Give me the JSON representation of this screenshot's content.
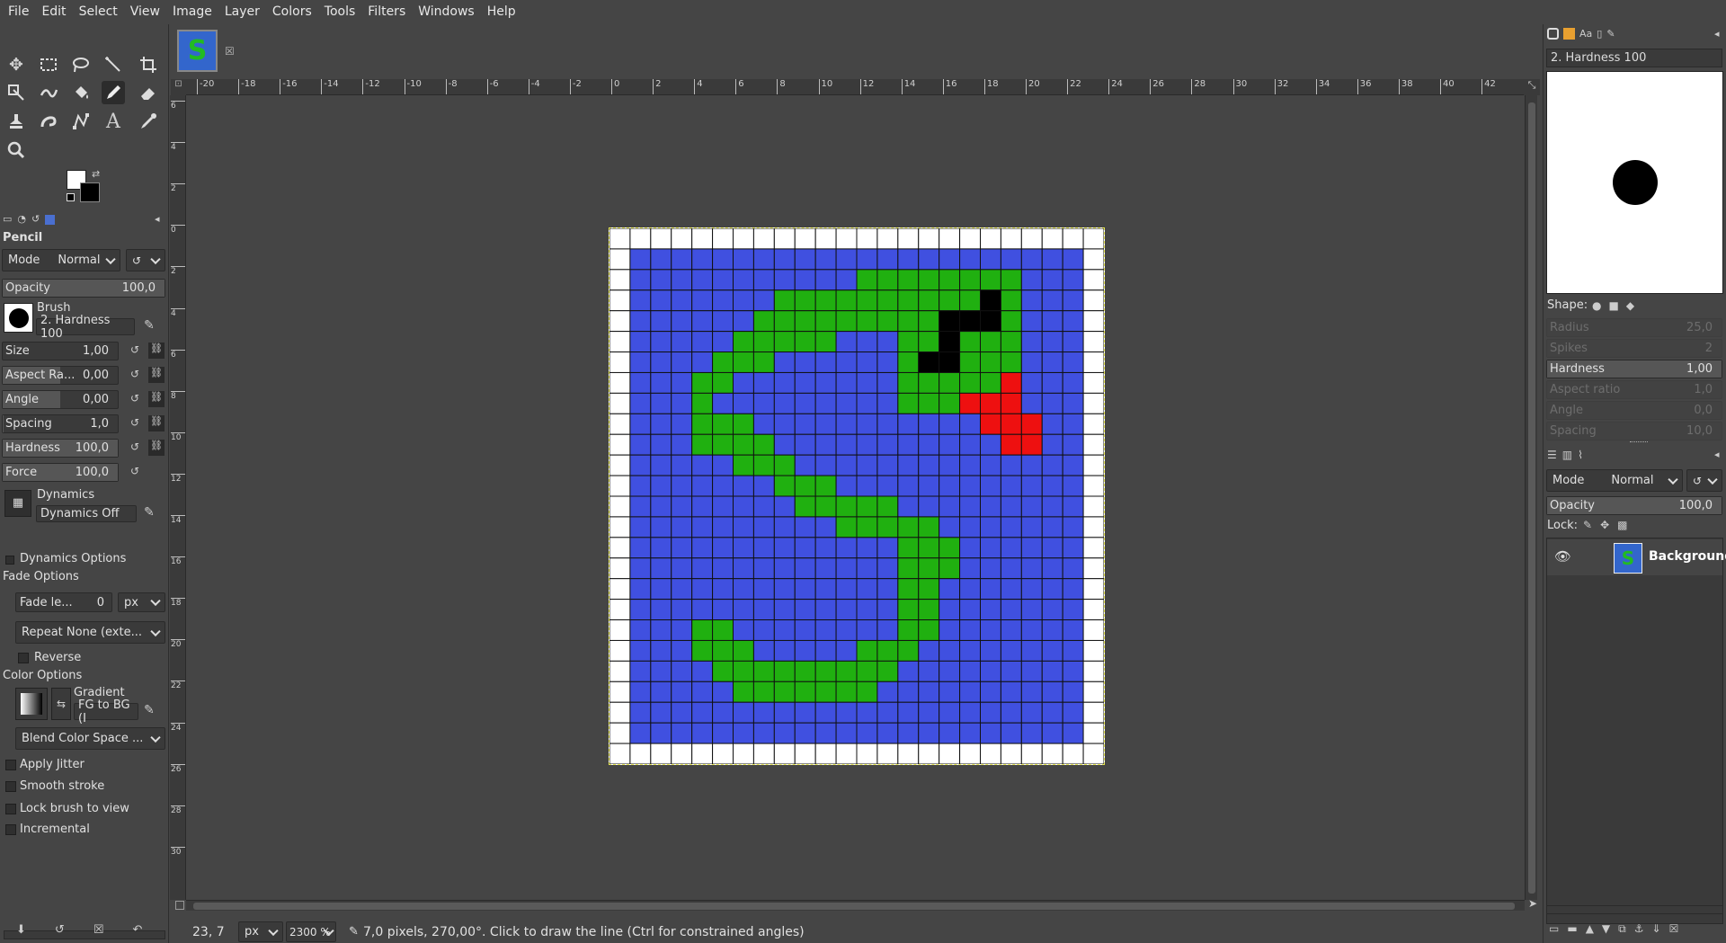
{
  "menu": [
    "File",
    "Edit",
    "Select",
    "View",
    "Image",
    "Layer",
    "Colors",
    "Tools",
    "Filters",
    "Windows",
    "Help"
  ],
  "tool_options": {
    "title": "Pencil",
    "mode_label": "Mode",
    "mode_value": "Normal",
    "opacity_label": "Opacity",
    "opacity_value": "100,0",
    "brush_label": "Brush",
    "brush_value": "2. Hardness 100",
    "size_label": "Size",
    "size_value": "1,00",
    "aspect_label": "Aspect Ra...",
    "aspect_value": "0,00",
    "angle_label": "Angle",
    "angle_value": "0,00",
    "spacing_label": "Spacing",
    "spacing_value": "1,0",
    "hardness_label": "Hardness",
    "hardness_value": "100,0",
    "force_label": "Force",
    "force_value": "100,0",
    "dynamics_label": "Dynamics",
    "dynamics_value": "Dynamics Off",
    "dynamics_options": "Dynamics Options",
    "fade_options": "Fade Options",
    "fade_length_label": "Fade le...",
    "fade_length_value": "0",
    "fade_unit": "px",
    "repeat_value": "Repeat None (exte...",
    "reverse_label": "Reverse",
    "color_options": "Color Options",
    "gradient_label": "Gradient",
    "gradient_value": "FG to BG (I",
    "blend_value": "Blend Color Space ...",
    "apply_jitter": "Apply Jitter",
    "smooth_stroke": "Smooth stroke",
    "lock_brush": "Lock brush to view",
    "incremental": "Incremental"
  },
  "hruler_ticks": [
    "-20",
    "-18",
    "-16",
    "-14",
    "-12",
    "-10",
    "-8",
    "-6",
    "-4",
    "-2",
    "0",
    "2",
    "4",
    "6",
    "8",
    "10",
    "12",
    "14",
    "16",
    "18",
    "20",
    "22",
    "24",
    "26",
    "28",
    "30",
    "32",
    "34",
    "36",
    "38",
    "40",
    "42"
  ],
  "vruler_ticks": [
    "6",
    "4",
    "2",
    "0",
    "2",
    "4",
    "6",
    "8",
    "10",
    "12",
    "14",
    "16",
    "18",
    "20",
    "22",
    "24",
    "26",
    "28",
    "30"
  ],
  "status": {
    "coords": "23, 7",
    "unit": "px",
    "zoom": "2300 %",
    "message": "7,0 pixels, 270,00°. Click to draw the line (Ctrl for constrained angles)"
  },
  "brushes_panel": {
    "brush_name": "2. Hardness 100",
    "shape_label": "Shape:",
    "radius_label": "Radius",
    "radius_value": "25,0",
    "spikes_label": "Spikes",
    "spikes_value": "2",
    "hardness_label": "Hardness",
    "hardness_value": "1,00",
    "aspect_label": "Aspect ratio",
    "aspect_value": "1,0",
    "angle_label": "Angle",
    "angle_value": "0,0",
    "spacing_label": "Spacing",
    "spacing_value": "10,0"
  },
  "layers_panel": {
    "mode_label": "Mode",
    "mode_value": "Normal",
    "opacity_label": "Opacity",
    "opacity_value": "100,0",
    "lock_label": "Lock:",
    "layer_name": "Background"
  },
  "colors": {
    "blue": "#4050e0",
    "green": "#20b010",
    "red": "#ee1010",
    "black": "#000000",
    "white": "#ffffff"
  },
  "pixel_art": {
    "legend": "W=white B=blue G=green K=black R=red",
    "rows": [
      "WWWWWWWWWWWWWWWWWWWWWWWW",
      "WBBBBBBBBBBBBBBBBBBBBBBW",
      "WBBBBBBBBBBBGGGGGGGGBBBW",
      "WBBBBBBBGGGGGGGGGGKGBBBW",
      "WBBBBBBGGGGGGGGGKKKGBBBW",
      "WBBBBBGGGGGBBBGGKGGGBBBW",
      "WBBBBGGGBBBBBBGKKGGGBBBW",
      "WBBBGGBBBBBBBBGGGGGRBBBW",
      "WBBBGBBBBBBBBBGGGRRRBBBW",
      "WBBBGGGBBBBBBBBBBBRRRBBW",
      "WBBBGGGGBBBBBBBBBBBRRBBW",
      "WBBBBBGGGBBBBBBBBBBBBBBW",
      "WBBBBBBBGGGBBBBBBBBBBBBW",
      "WBBBBBBBBGGGGGBBBBBBBBBW",
      "WBBBBBBBBBBGGGGGBBBBBBBW",
      "WBBBBBBBBBBBBBGGGBBBBBBW",
      "WBBBBBBBBBBBBBGGGBBBBBBW",
      "WBBBBBBBBBBBBBGGBBBBBBBW",
      "WBBBBBBBBBBBBBGGBBBBBBBW",
      "WBBBGGBBBBBBBBGGBBBBBBBW",
      "WBBBGGGBBBBBGGGBBBBBBBBW",
      "WBBBBGGGGGGGGGBBBBBBBBBW",
      "WBBBBBGGGGGGGBBBBBBBBBBW",
      "WBBBBBBBBBBBBBBBBBBBBBBW",
      "WBBBBBBBBBBBBBBBBBBBBBBW",
      "WWWWWWWWWWWWWWWWWWWWWWWW"
    ]
  }
}
